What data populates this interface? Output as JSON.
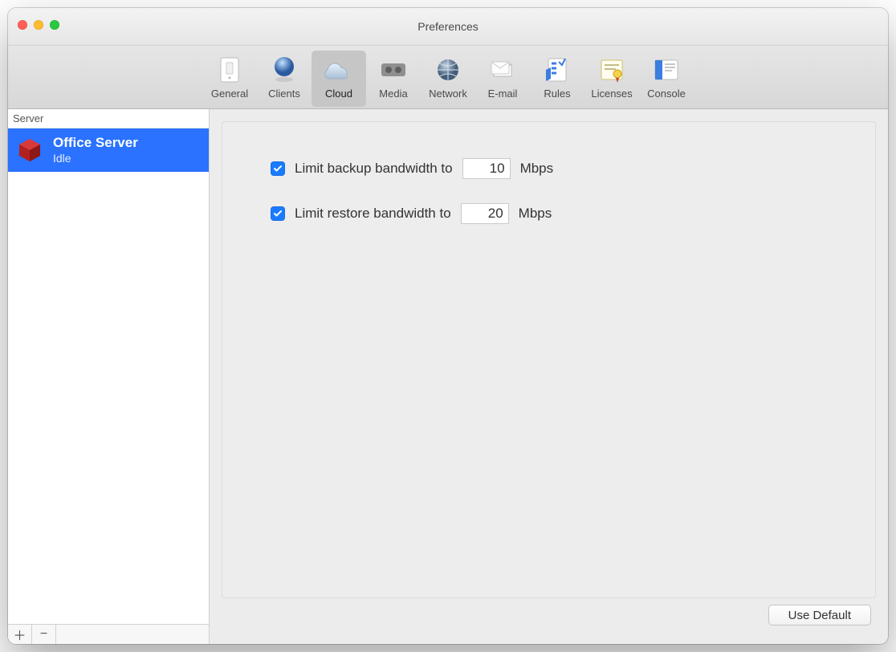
{
  "window": {
    "title": "Preferences"
  },
  "toolbar": {
    "items": [
      {
        "id": "general",
        "label": "General"
      },
      {
        "id": "clients",
        "label": "Clients"
      },
      {
        "id": "cloud",
        "label": "Cloud",
        "selected": true
      },
      {
        "id": "media",
        "label": "Media"
      },
      {
        "id": "network",
        "label": "Network"
      },
      {
        "id": "email",
        "label": "E-mail"
      },
      {
        "id": "rules",
        "label": "Rules"
      },
      {
        "id": "licenses",
        "label": "Licenses"
      },
      {
        "id": "console",
        "label": "Console"
      }
    ]
  },
  "sidebar": {
    "heading": "Server",
    "items": [
      {
        "name": "Office Server",
        "status": "Idle"
      }
    ],
    "add_tooltip": "+",
    "remove_tooltip": "−"
  },
  "settings": {
    "backup": {
      "checked": true,
      "label": "Limit backup bandwidth to",
      "value": "10",
      "unit": "Mbps"
    },
    "restore": {
      "checked": true,
      "label": "Limit restore bandwidth to",
      "value": "20",
      "unit": "Mbps"
    }
  },
  "buttons": {
    "use_default": "Use Default"
  }
}
